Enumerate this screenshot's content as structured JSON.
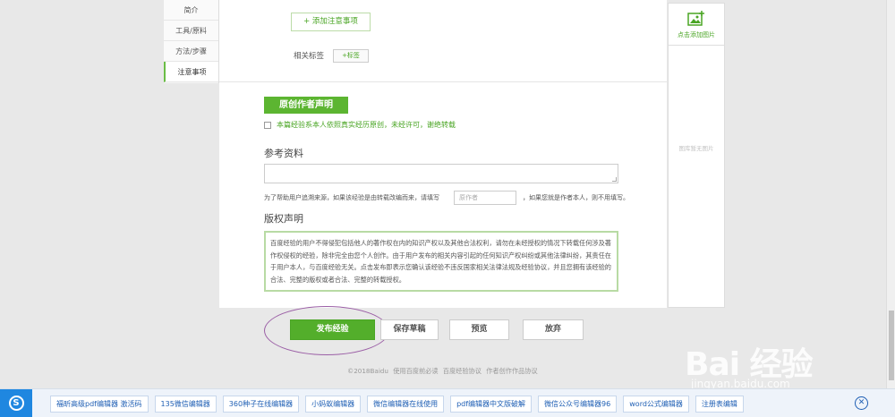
{
  "leftnav": {
    "items": [
      {
        "label": "简介"
      },
      {
        "label": "工具/原料"
      },
      {
        "label": "方法/步骤"
      },
      {
        "label": "注意事项"
      }
    ]
  },
  "editor": {
    "add_note_label": "+ 添加注意事项",
    "tags_label": "相关标签",
    "tag_button": "+标签",
    "author_declaration": "原创作者声明",
    "original_text": "本篇经验系本人依照真实经历原创，未经许可，谢绝转载",
    "reference_title": "参考资料",
    "track_prefix": "为了帮助用户追溯来源，如果该经验是由转载改编而来，请填写",
    "author_placeholder": "原作者",
    "track_suffix": "，如果您就是作者本人，则不用填写。",
    "copyright_title": "版权声明",
    "copyright_text": "百度经验的用户不得侵犯包括他人的著作权在内的知识产权以及其他合法权利，请勿在未经授权的情况下转载任何涉及著作权侵权的经验，除非完全由您个人创作。由于用户发布的相关内容引起的任何知识产权纠纷或其他法律纠纷，其责任在于用户本人，与百度经验无关。点击发布即表示您确认该经验不违反国家相关法律法规及经验协议，并且您拥有该经验的合法、完整的版权或者合法、完整的转载授权。"
  },
  "sidebar": {
    "add_image_label": "点击添加图片",
    "empty_label": "图库暂无图片"
  },
  "actions": {
    "publish": "发布经验",
    "save_draft": "保存草稿",
    "preview": "预览",
    "discard": "放弃"
  },
  "footer": {
    "text": "©2018Baidu 使用百度前必读 百度经验协议 作者创作作品协议"
  },
  "watermark": {
    "brand": "Bai 经验",
    "url": "jingyan.baidu.com"
  },
  "adbar": {
    "logo_glyph": "S",
    "items": [
      {
        "label": "福昕高级pdf编辑器 激活码"
      },
      {
        "label": "135微信编辑器"
      },
      {
        "label": "360种子在线编辑器"
      },
      {
        "label": "小蚂蚁编辑器"
      },
      {
        "label": "微信编辑器在线使用"
      },
      {
        "label": "pdf编辑器中文版破解"
      },
      {
        "label": "微信公众号编辑器96"
      },
      {
        "label": "word公式编辑器"
      },
      {
        "label": "注册表编辑"
      }
    ],
    "close_glyph": "✕"
  },
  "colors": {
    "accent_green": "#53ae2b",
    "highlight_purple": "#9b5fa6",
    "ad_blue": "#1f87e0"
  }
}
